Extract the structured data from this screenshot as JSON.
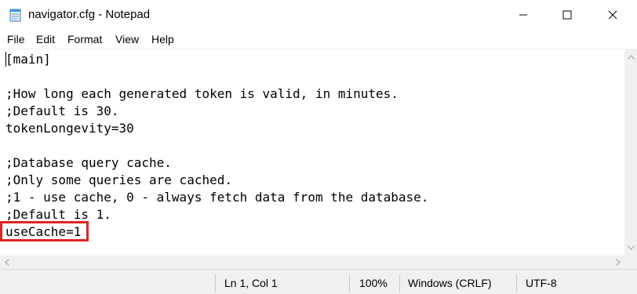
{
  "window": {
    "title": "navigator.cfg - Notepad",
    "minimize_icon": "minimize-icon",
    "maximize_icon": "maximize-icon",
    "close_icon": "close-icon"
  },
  "menu": {
    "file": "File",
    "edit": "Edit",
    "format": "Format",
    "view": "View",
    "help": "Help"
  },
  "editor": {
    "lines": [
      "[main]",
      "",
      ";How long each generated token is valid, in minutes.",
      ";Default is 30.",
      "tokenLongevity=30",
      "",
      ";Database query cache.",
      ";Only some queries are cached.",
      ";1 - use cache, 0 - always fetch data from the database.",
      ";Default is 1.",
      "useCache=1"
    ],
    "highlight_color": "#e02424"
  },
  "status": {
    "position": "Ln 1, Col 1",
    "zoom": "100%",
    "line_endings": "Windows (CRLF)",
    "encoding": "UTF-8"
  }
}
